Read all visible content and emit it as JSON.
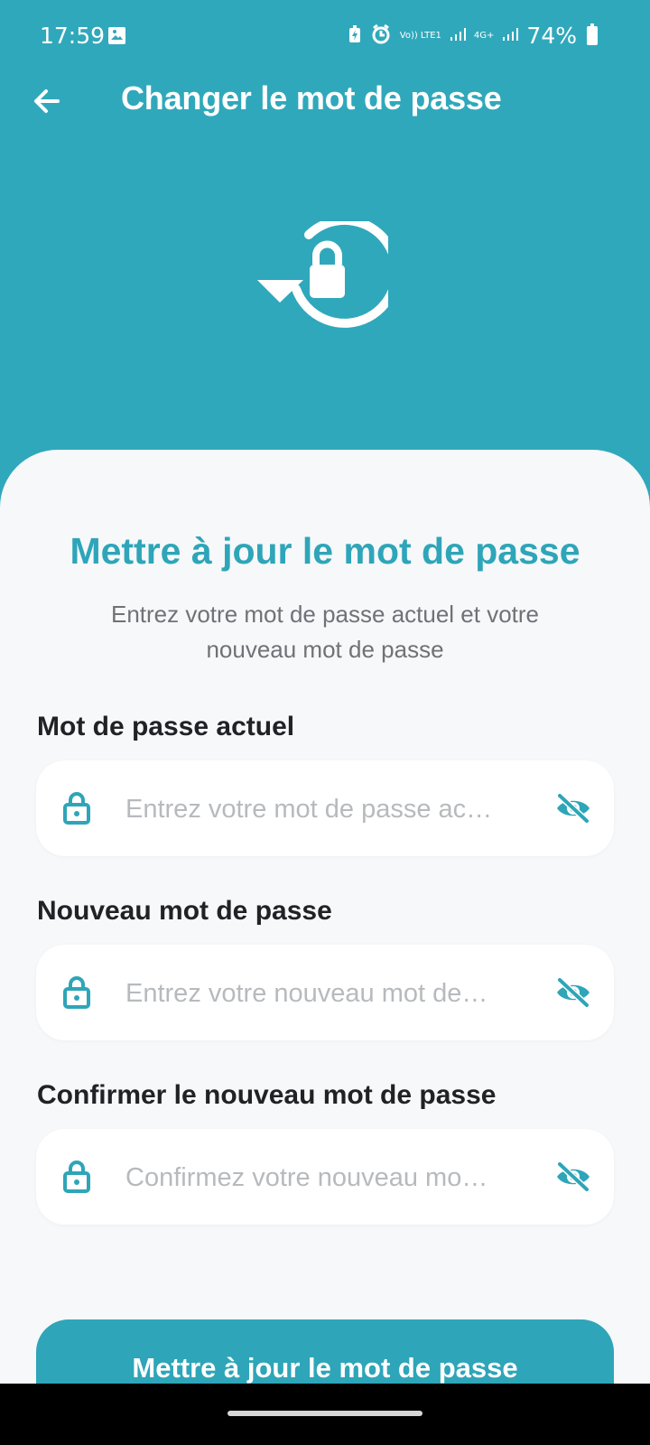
{
  "status_bar": {
    "time": "17:59",
    "network_label_1": "Vo)) LTE1",
    "network_label_2": "4G+",
    "battery": "74%"
  },
  "header": {
    "title": "Changer le mot de passe"
  },
  "card": {
    "title": "Mettre à jour le mot de passe",
    "subtitle": "Entrez votre mot de passe actuel et votre nouveau mot de passe"
  },
  "fields": [
    {
      "label": "Mot de passe actuel",
      "placeholder": "Entrez votre mot de passe ac…",
      "value": ""
    },
    {
      "label": "Nouveau mot de passe",
      "placeholder": "Entrez votre nouveau mot de…",
      "value": ""
    },
    {
      "label": "Confirmer le nouveau mot de passe",
      "placeholder": "Confirmez votre nouveau mo…",
      "value": ""
    }
  ],
  "actions": {
    "submit_label": "Mettre à jour le mot de passe"
  },
  "icons": {
    "back": "arrow-left-icon",
    "hero": "password-reset-lock-icon",
    "field_lock": "lock-icon",
    "visibility": "eye-off-icon"
  },
  "colors": {
    "accent": "#30a8bb",
    "background": "#f6f8fa",
    "text": "#202226",
    "placeholder": "#b7babd"
  }
}
